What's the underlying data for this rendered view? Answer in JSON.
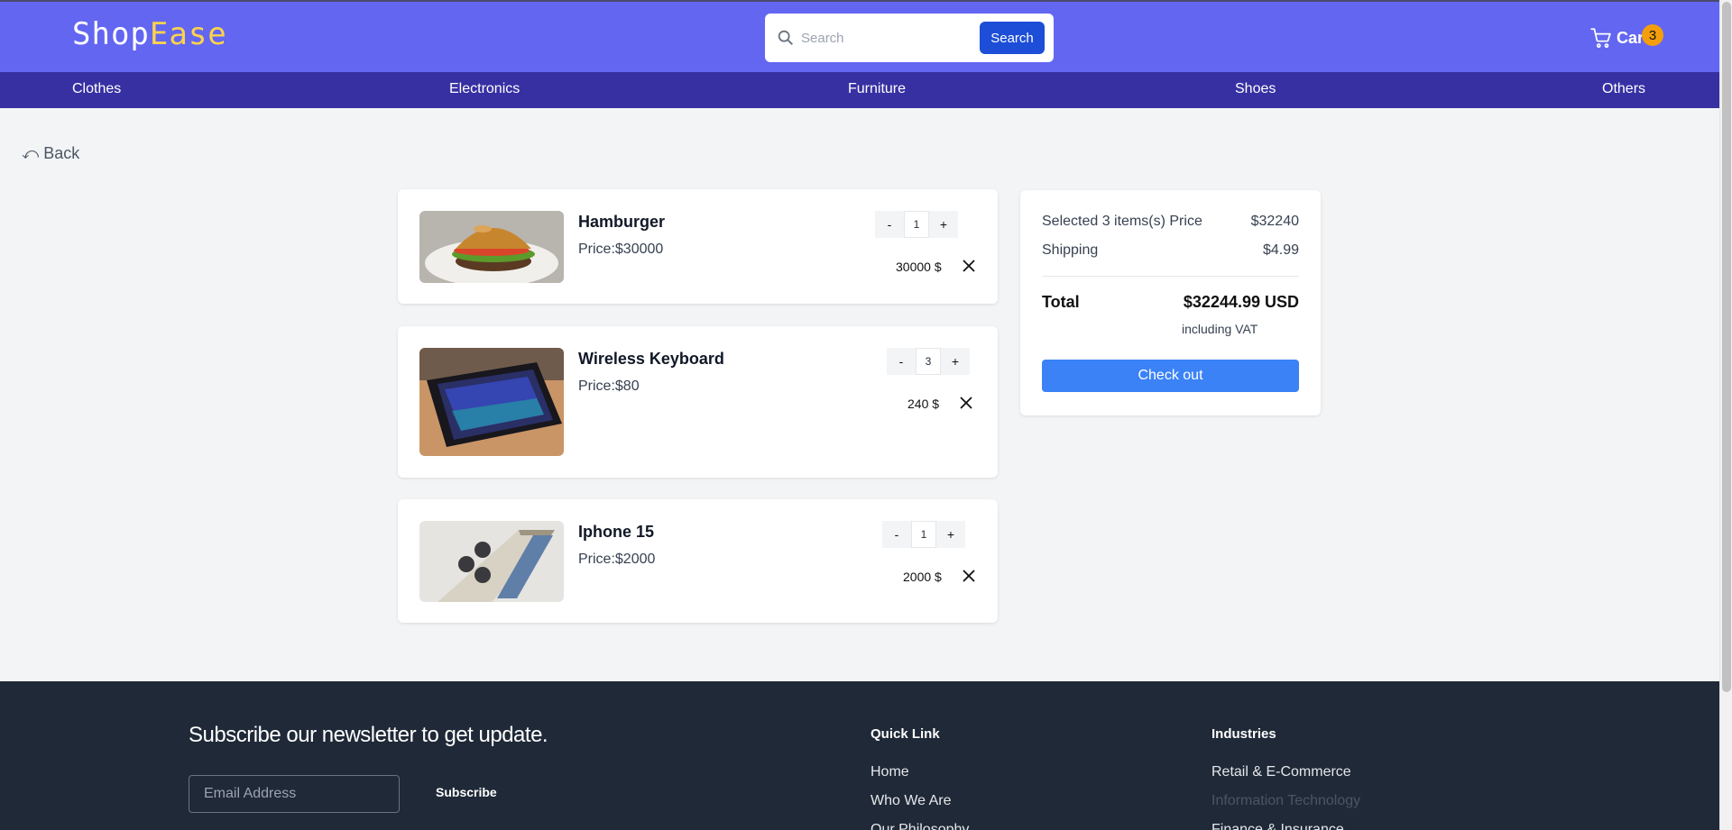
{
  "header": {
    "logo_part1": "Shop",
    "logo_part2": "Ease",
    "search_placeholder": "Search",
    "search_button": "Search",
    "cart_label": "Cart",
    "cart_count": "3"
  },
  "categories": [
    "Clothes",
    "Electronics",
    "Furniture",
    "Shoes",
    "Others"
  ],
  "back_label": "Back",
  "cart_items": [
    {
      "name": "Hamburger",
      "price": "Price:$30000",
      "qty": "1",
      "line_total": "30000 $",
      "image": "hamburger"
    },
    {
      "name": "Wireless Keyboard",
      "price": "Price:$80",
      "qty": "3",
      "line_total": "240 $",
      "image": "keyboard"
    },
    {
      "name": "Iphone 15",
      "price": "Price:$2000",
      "qty": "1",
      "line_total": "2000 $",
      "image": "phone"
    }
  ],
  "stepper": {
    "minus": "-",
    "plus": "+"
  },
  "summary": {
    "selected_label": "Selected 3 items(s) Price",
    "selected_value": "$32240",
    "shipping_label": "Shipping",
    "shipping_value": "$4.99",
    "total_label": "Total",
    "total_value": "$32244.99 USD",
    "vat_note": "including VAT",
    "checkout": "Check out"
  },
  "footer": {
    "newsletter_title": "Subscribe our newsletter to get update.",
    "email_placeholder": "Email Address",
    "subscribe": "Subscribe",
    "quick_link_title": "Quick Link",
    "quick_links": [
      "Home",
      "Who We Are",
      "Our Philosophy"
    ],
    "industries_title": "Industries",
    "industries": [
      "Retail & E-Commerce",
      "Information Technology",
      "Finance & Insurance"
    ]
  },
  "colors": {
    "header_bg": "#6366f1",
    "nav_bg": "#3730a3",
    "accent": "#3b82f6",
    "badge": "#f59e0b",
    "footer_bg": "#1f2937"
  }
}
